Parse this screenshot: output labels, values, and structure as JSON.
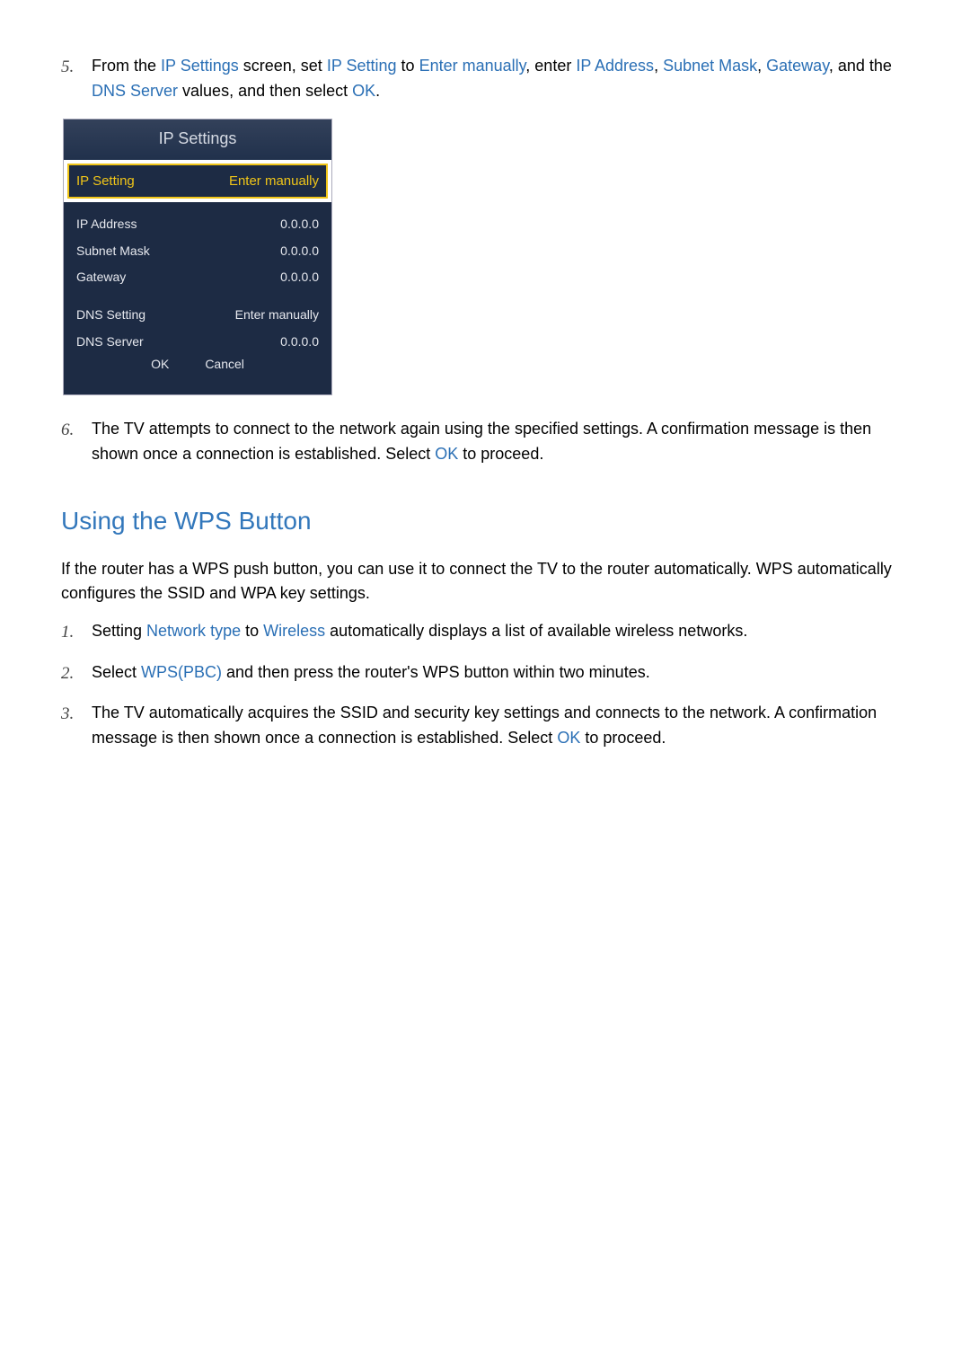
{
  "step5": {
    "num": "5.",
    "t1": "From the ",
    "ip_settings": "IP Settings",
    "t2": " screen, set ",
    "ip_setting": "IP Setting",
    "t3": " to ",
    "enter_manually": "Enter manually",
    "t4": ", enter ",
    "ip_address": "IP Address",
    "t5": ", ",
    "subnet_mask": "Subnet Mask",
    "t6": ", ",
    "gateway": "Gateway",
    "t7": ", and the ",
    "dns_server": "DNS Server",
    "t8": " values, and then select ",
    "ok": "OK",
    "t9": "."
  },
  "panel": {
    "title": "IP Settings",
    "ip_setting_label": "IP Setting",
    "ip_setting_value": "Enter manually",
    "rows": {
      "ip_address_l": "IP Address",
      "ip_address_v": "0.0.0.0",
      "subnet_l": "Subnet Mask",
      "subnet_v": "0.0.0.0",
      "gateway_l": "Gateway",
      "gateway_v": "0.0.0.0",
      "dns_setting_l": "DNS Setting",
      "dns_setting_v": "Enter manually",
      "dns_server_l": "DNS Server",
      "dns_server_v": "0.0.0.0"
    },
    "ok": "OK",
    "cancel": "Cancel"
  },
  "step6": {
    "num": "6.",
    "t1": "The TV attempts to connect to the network again using the specified settings. A confirmation message is then shown once a connection is established. Select ",
    "ok": "OK",
    "t2": " to proceed."
  },
  "wps": {
    "heading": "Using the WPS Button",
    "intro": "If the router has a WPS push button, you can use it to connect the TV to the router automatically. WPS automatically configures the SSID and WPA key settings.",
    "s1": {
      "num": "1.",
      "t1": "Setting ",
      "network_type": "Network type",
      "t2": " to ",
      "wireless": "Wireless",
      "t3": " automatically displays a list of available wireless networks."
    },
    "s2": {
      "num": "2.",
      "t1": "Select ",
      "wps_pbc": "WPS(PBC)",
      "t2": " and then press the router's WPS button within two minutes."
    },
    "s3": {
      "num": "3.",
      "t1": "The TV automatically acquires the SSID and security key settings and connects to the network. A confirmation message is then shown once a connection is established. Select ",
      "ok": "OK",
      "t2": " to proceed."
    }
  }
}
